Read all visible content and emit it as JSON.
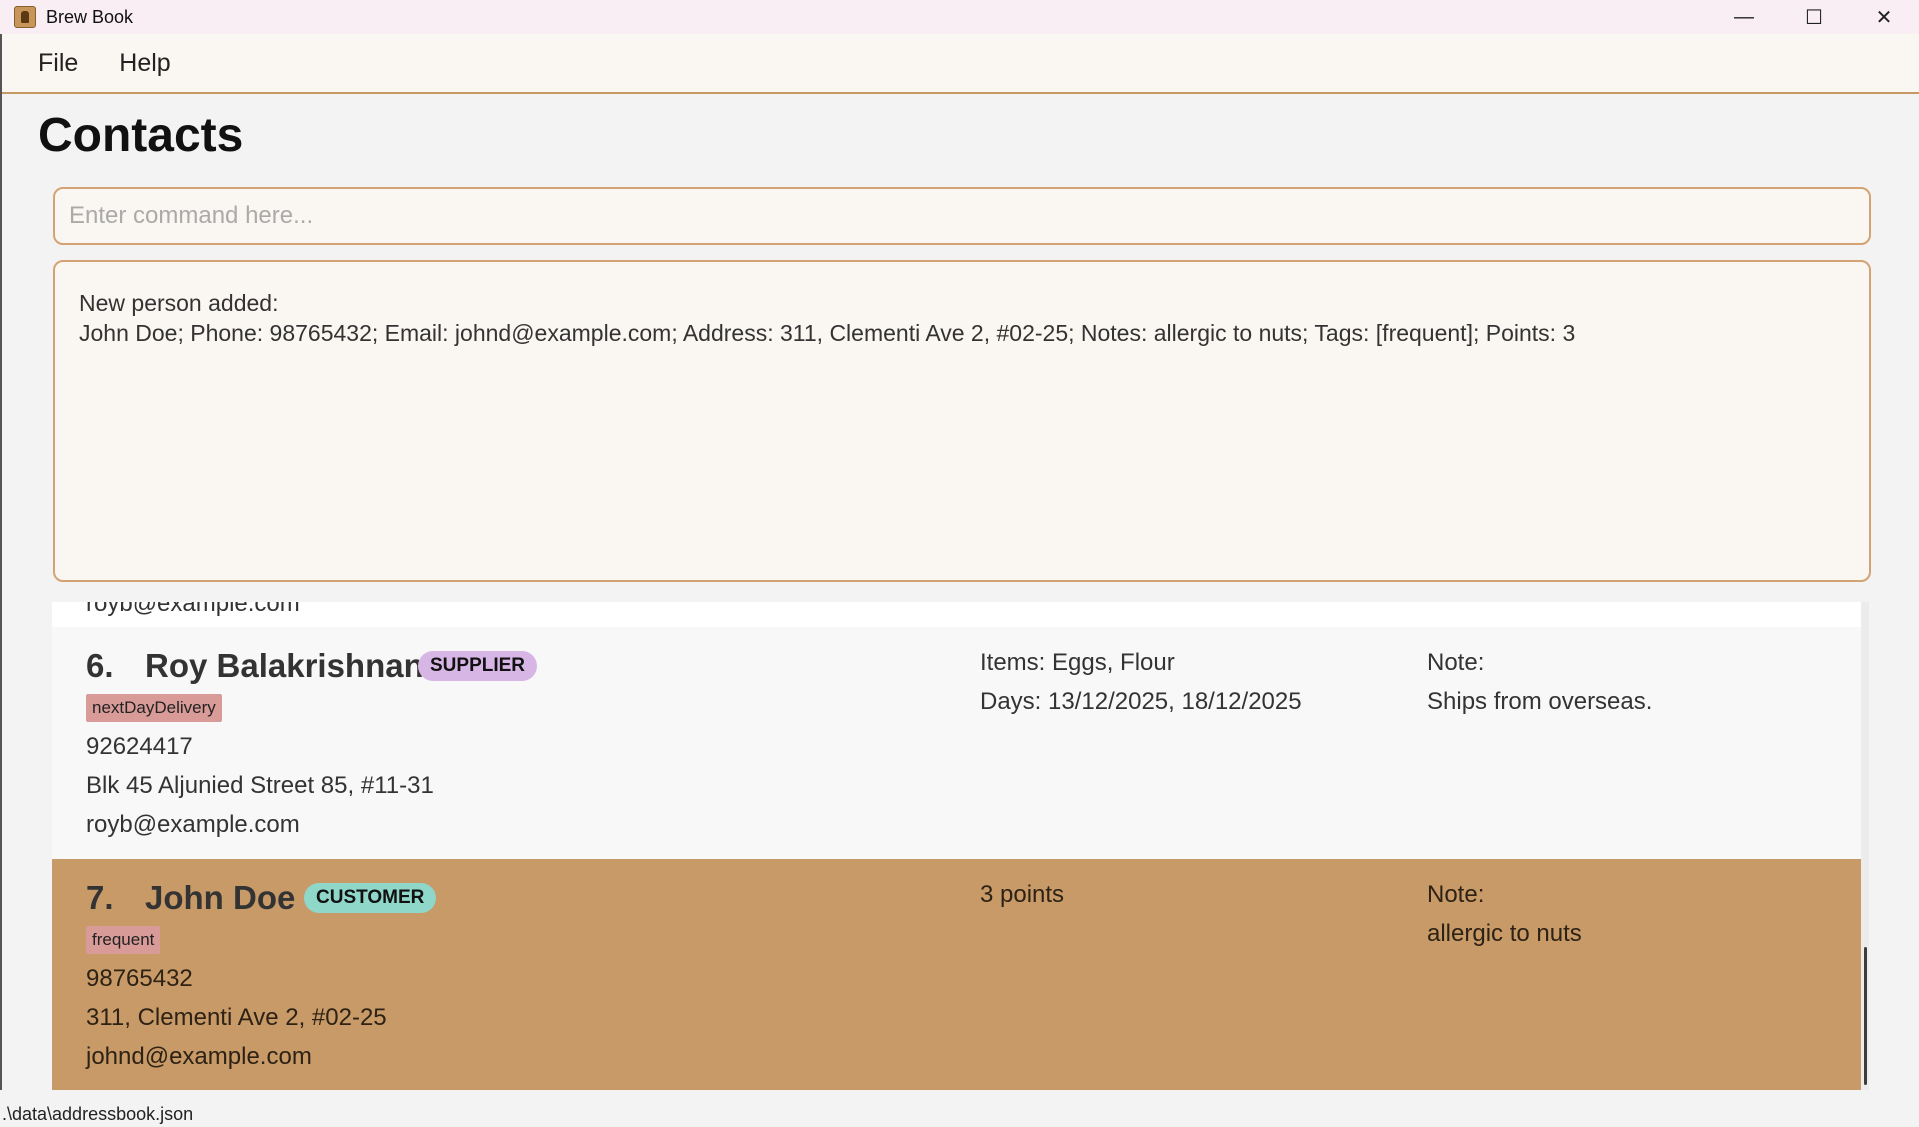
{
  "window": {
    "title": "Brew Book",
    "controls": {
      "minimize": "—",
      "maximize": "☐",
      "close": "✕"
    }
  },
  "menu": {
    "file": "File",
    "help": "Help"
  },
  "page": {
    "title": "Contacts"
  },
  "command": {
    "placeholder": "Enter command here...",
    "value": ""
  },
  "result": {
    "line1": "New person added:",
    "line2": "John Doe; Phone: 98765432; Email: johnd@example.com; Address: 311, Clementi Ave 2, #02-25; Notes: allergic to nuts; Tags: [frequent]; Points: 3"
  },
  "list": {
    "partial_text": "royb@example.com",
    "contacts": [
      {
        "index": "6.",
        "name": "Roy Balakrishnan",
        "type": "SUPPLIER",
        "tag": "nextDayDelivery",
        "phone": "92624417",
        "address": "Blk 45 Aljunied Street 85, #11-31",
        "email": "royb@example.com",
        "items": "Items:  Eggs, Flour",
        "days": "Days:  13/12/2025, 18/12/2025",
        "note_label": "Note:",
        "note": "Ships from overseas."
      },
      {
        "index": "7.",
        "name": "John Doe",
        "type": "CUSTOMER",
        "tag": "frequent",
        "phone": "98765432",
        "address": "311, Clementi Ave 2, #02-25",
        "email": "johnd@example.com",
        "points": "3 points",
        "note_label": "Note:",
        "note": "allergic to nuts"
      }
    ]
  },
  "status": {
    "path": ".\\data\\addressbook.json"
  },
  "colors": {
    "accent": "#c79a68",
    "supplier_badge": "#d7b6e6",
    "customer_badge": "#8fd7c9",
    "tag": "#d89b98"
  }
}
